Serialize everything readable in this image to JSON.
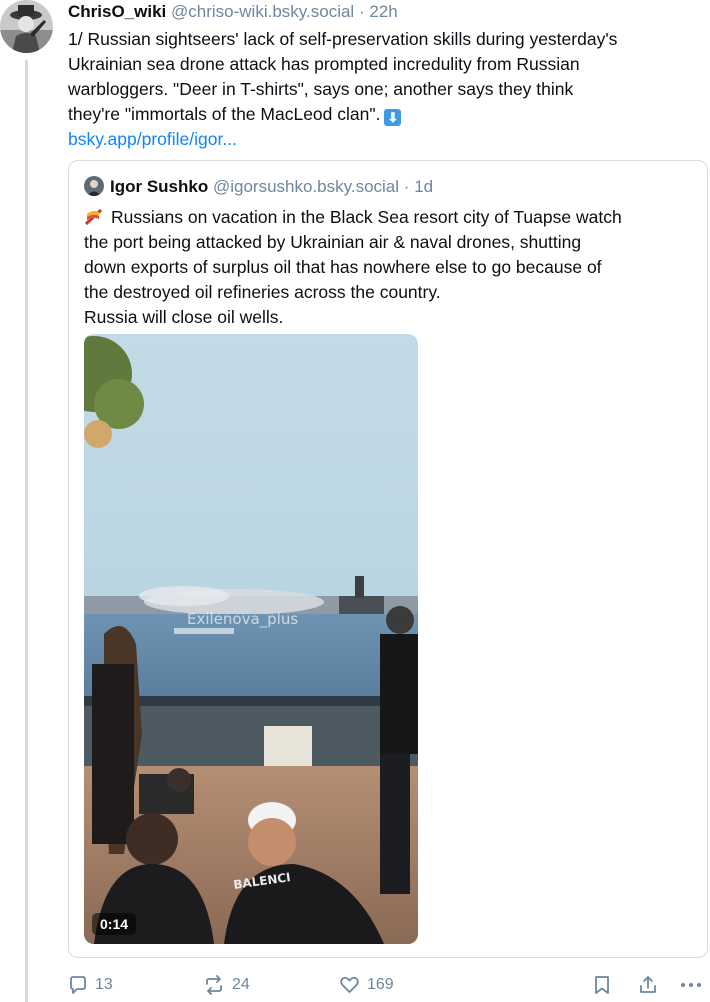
{
  "post": {
    "author_name": "ChrisO_wiki",
    "author_handle": "@chriso-wiki.bsky.social",
    "separator": "·",
    "timestamp": "22h",
    "text_lines": [
      "1/ Russian sightseers' lack of self-preservation skills during yesterday's",
      "Ukrainian sea drone attack has prompted incredulity from Russian",
      "warbloggers. \"Deer in T-shirts\", says one; another says they think",
      "they're \"immortals of the MacLeod clan\"."
    ],
    "down_emoji": "⬇",
    "link": "bsky.app/profile/igor..."
  },
  "quote": {
    "author_name": "Igor Sushko",
    "author_handle": "@igorsushko.bsky.social",
    "separator": "·",
    "timestamp": "1d",
    "text_lines": [
      "Russians on vacation in the Black Sea resort city of Tuapse watch",
      "the port being attacked by Ukrainian air & naval drones, shutting",
      "down exports of surplus oil that has nowhere else to go because of",
      "the destroyed oil refineries across the country.",
      "Russia will close oil wells."
    ],
    "video": {
      "watermark": "Exilenova_plus",
      "shirt_text": "BALENCI",
      "duration": "0:14"
    }
  },
  "actions": {
    "replies": "13",
    "reposts": "24",
    "likes": "169"
  },
  "icons": [
    "reply-icon",
    "repost-icon",
    "like-icon",
    "bookmark-icon",
    "share-icon",
    "more-icon"
  ],
  "colors": {
    "link": "#1083fe",
    "muted": "#6f869f",
    "border": "#d4dbe2"
  }
}
